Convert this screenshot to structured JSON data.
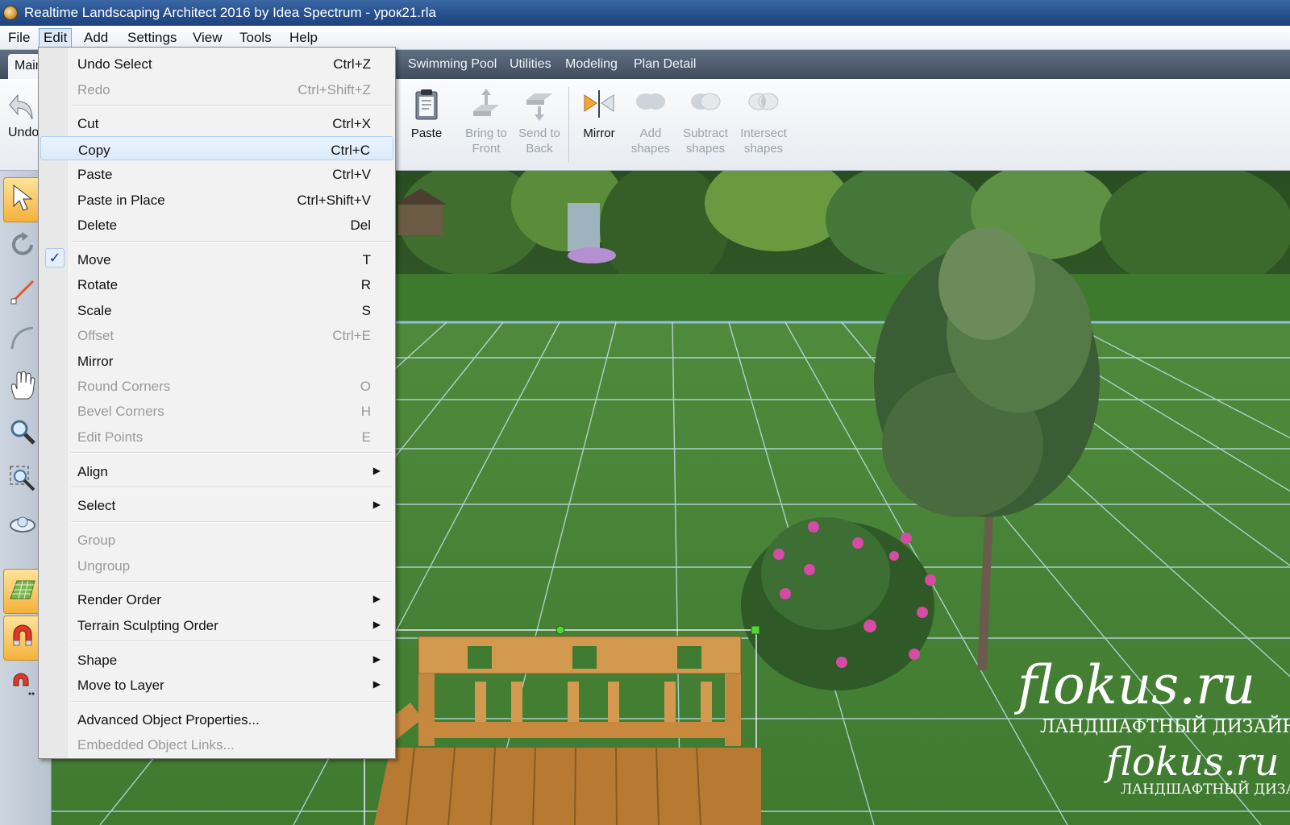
{
  "window": {
    "title": "Realtime Landscaping Architect 2016 by Idea Spectrum - урок21.rla"
  },
  "menubar": [
    "File",
    "Edit",
    "Add",
    "Settings",
    "View",
    "Tools",
    "Help"
  ],
  "ribbon": {
    "main_tab": "Main",
    "tabs": [
      "Swimming Pool",
      "Utilities",
      "Modeling",
      "Plan Detail"
    ]
  },
  "toolbar": {
    "undo": "Undo",
    "paste": "Paste",
    "bring_front": [
      "Bring to",
      "Front"
    ],
    "send_back": [
      "Send to",
      "Back"
    ],
    "mirror": "Mirror",
    "add_shapes": [
      "Add",
      "shapes"
    ],
    "subtract_shapes": [
      "Subtract",
      "shapes"
    ],
    "intersect_shapes": [
      "Intersect",
      "shapes"
    ]
  },
  "edit_menu": {
    "undo_select": {
      "label": "Undo Select",
      "shortcut": "Ctrl+Z"
    },
    "redo": {
      "label": "Redo",
      "shortcut": "Ctrl+Shift+Z"
    },
    "cut": {
      "label": "Cut",
      "shortcut": "Ctrl+X"
    },
    "copy": {
      "label": "Copy",
      "shortcut": "Ctrl+C"
    },
    "paste": {
      "label": "Paste",
      "shortcut": "Ctrl+V"
    },
    "paste_in_place": {
      "label": "Paste in Place",
      "shortcut": "Ctrl+Shift+V"
    },
    "delete": {
      "label": "Delete",
      "shortcut": "Del"
    },
    "move": {
      "label": "Move",
      "shortcut": "T",
      "checked": true
    },
    "rotate": {
      "label": "Rotate",
      "shortcut": "R"
    },
    "scale": {
      "label": "Scale",
      "shortcut": "S"
    },
    "offset": {
      "label": "Offset",
      "shortcut": "Ctrl+E"
    },
    "mirror": {
      "label": "Mirror",
      "shortcut": ""
    },
    "round_corners": {
      "label": "Round Corners",
      "shortcut": "O"
    },
    "bevel_corners": {
      "label": "Bevel Corners",
      "shortcut": "H"
    },
    "edit_points": {
      "label": "Edit Points",
      "shortcut": "E"
    },
    "align": {
      "label": "Align"
    },
    "select": {
      "label": "Select"
    },
    "group": {
      "label": "Group"
    },
    "ungroup": {
      "label": "Ungroup"
    },
    "render_order": {
      "label": "Render Order"
    },
    "terrain_sculpting_order": {
      "label": "Terrain Sculpting Order"
    },
    "shape": {
      "label": "Shape"
    },
    "move_to_layer": {
      "label": "Move to Layer"
    },
    "advanced_props": {
      "label": "Advanced Object Properties..."
    },
    "embedded_links": {
      "label": "Embedded Object Links..."
    }
  },
  "watermark": {
    "brand": "flokus.ru",
    "tagline": "ЛАНДШАФТНЫЙ ДИЗАЙН"
  },
  "colors": {
    "accent": "#274f8d",
    "menu_highlight": "#dbeaf9",
    "grass": "#4d8e3d"
  }
}
